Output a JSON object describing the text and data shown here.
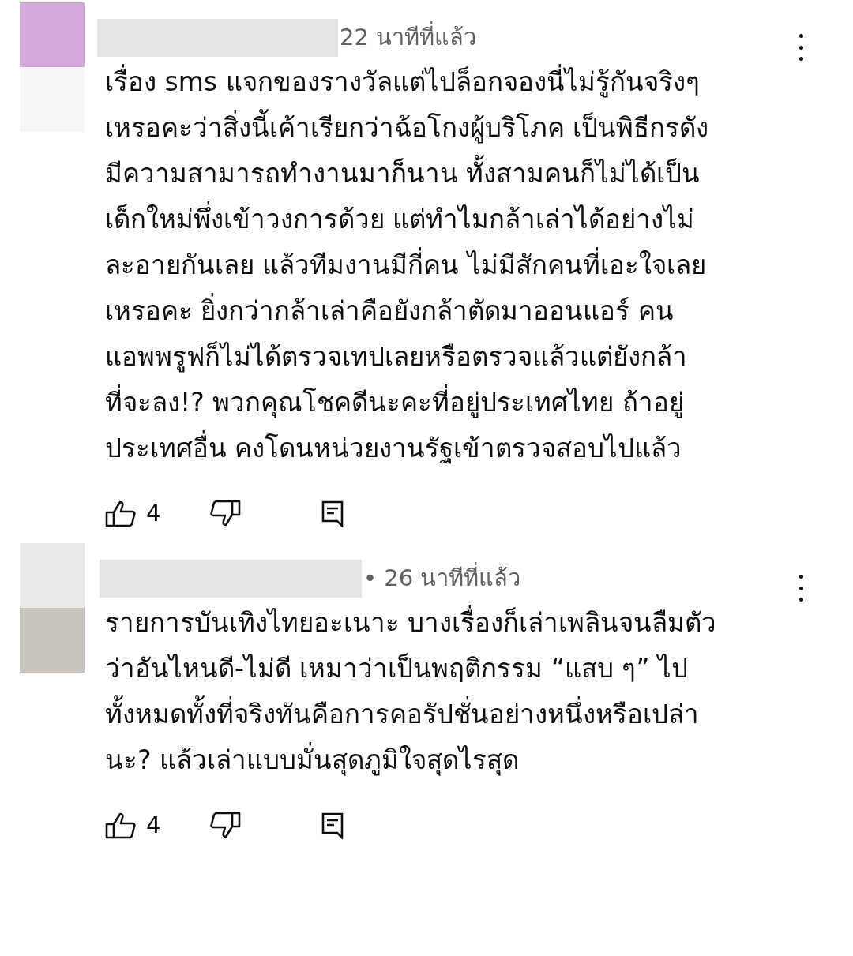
{
  "comments": [
    {
      "avatar": [
        {
          "color": "#d3a9dc"
        },
        {
          "color": "#f7f7f7"
        }
      ],
      "time": "22 นาทีที่แล้ว",
      "text": "เรื่อง sms แจกของรางวัลแต่ไปล็อกจองนี่ไม่รู้กันจริงๆ\nเหรอคะว่าสิ่งนี้เค้าเรียกว่าฉ้อโกงผู้บริโภค เป็นพิธีกรดัง\nมีความสามารถทำงานมาก็นาน ทั้งสามคนก็ไม่ได้เป็น\nเด็กใหม่พึ่งเข้าวงการด้วย แต่ทำไมกล้าเล่าได้อย่างไม่\nละอายกันเลย แล้วทีมงานมีกี่คน ไม่มีสักคนที่เอะใจเลย\nเหรอคะ ยิ่งกว่ากล้าเล่าคือยังกล้าตัดมาออนแอร์ คน\nแอพพรูฟก็ไม่ได้ตรวจเทปเลยหรือตรวจแล้วแต่ยังกล้า\nที่จะลง!? พวกคุณโชคดีนะคะที่อยู่ประเทศไทย ถ้าอยู่\nประเทศอื่น คงโดนหน่วยงานรัฐเข้าตรวจสอบไปแล้ว",
      "likes": "4"
    },
    {
      "avatar": [
        {
          "color": "#ebe9e8"
        },
        {
          "color": "#c9c3bd"
        }
      ],
      "time": "• 26 นาทีที่แล้ว",
      "text": "รายการบันเทิงไทยอะเนาะ บางเรื่องก็เล่าเพลินจนลืมตัว\nว่าอันไหนดี-ไม่ดี เหมาว่าเป็นพฤติกรรม “แสบ ๆ” ไป\nทั้งหมดทั้งที่จริงทันคือการคอรัปชั่นอย่างหนึ่งหรือเปล่า\nนะ? แล้วเล่าแบบมั่นสุดภูมิใจสุดไรสุด",
      "likes": "4"
    }
  ]
}
